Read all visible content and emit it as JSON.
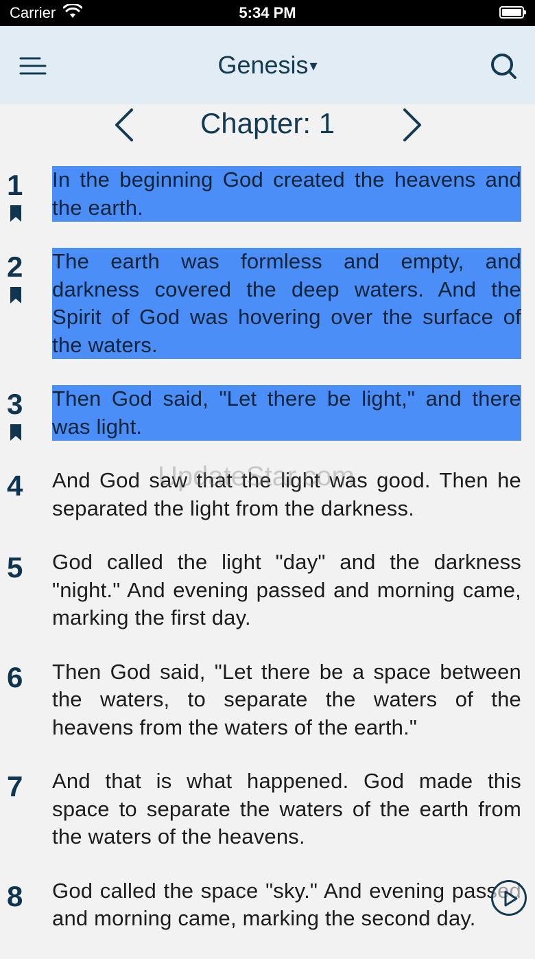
{
  "status_bar": {
    "carrier": "Carrier",
    "time": "5:34 PM"
  },
  "header": {
    "book": "Genesis",
    "caret": "▾"
  },
  "chapter_nav": {
    "label": "Chapter: 1"
  },
  "verses": [
    {
      "num": "1",
      "text": "In the beginning God created the heavens and the earth.",
      "highlighted": true,
      "bookmarked": true
    },
    {
      "num": "2",
      "text": "The earth was formless and empty, and darkness covered the deep waters. And the Spirit of God was hovering over the surface of the waters.",
      "highlighted": true,
      "bookmarked": true
    },
    {
      "num": "3",
      "text": "Then God said, \"Let there be light,\" and there was light.",
      "highlighted": true,
      "bookmarked": true
    },
    {
      "num": "4",
      "text": "And God saw that the light was good. Then he separated the light from the darkness.",
      "highlighted": false,
      "bookmarked": false
    },
    {
      "num": "5",
      "text": "God called the light \"day\" and the darkness \"night.\" And evening passed and morning came, marking the first day.",
      "highlighted": false,
      "bookmarked": false
    },
    {
      "num": "6",
      "text": "Then God said, \"Let there be a space between the waters, to separate the waters of the heavens from the waters of the earth.\"",
      "highlighted": false,
      "bookmarked": false
    },
    {
      "num": "7",
      "text": "And that is what happened. God made this space to separate the waters of the earth from the waters of the heavens.",
      "highlighted": false,
      "bookmarked": false
    },
    {
      "num": "8",
      "text": "God called the space \"sky.\" And evening passed and morning came, marking the second day.",
      "highlighted": false,
      "bookmarked": false
    }
  ],
  "watermark": "UpdateStar.com",
  "colors": {
    "highlight": "#4b8ef7",
    "header_bg": "#e2ecf5",
    "accent": "#123a52"
  },
  "icons": {
    "menu": "menu-icon",
    "search": "search-icon",
    "prev": "chevron-left-icon",
    "next": "chevron-right-icon",
    "bookmark": "bookmark-icon",
    "play": "play-icon"
  }
}
